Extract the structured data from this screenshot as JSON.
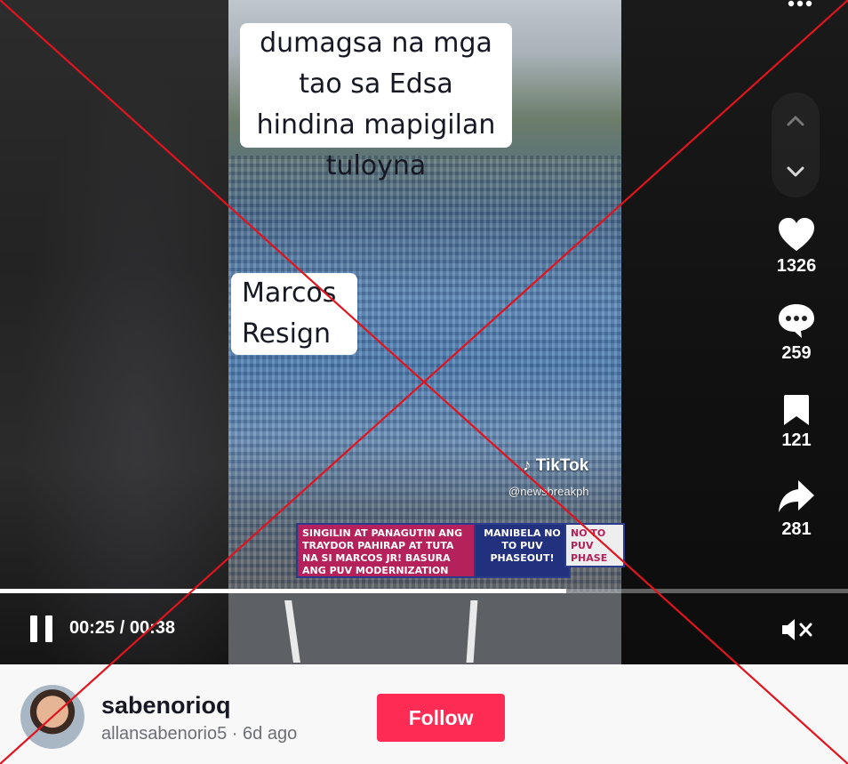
{
  "video": {
    "caption_top": "dumagsa na mga tao sa Edsa hindina mapigilan tuloyna",
    "caption_mid": "Marcos Resign",
    "banner_left": "SINGILIN AT PANAGUTIN ANG TRAYDOR PAHIRAP AT TUTA NA SI MARCOS JR! BASURA ANG PUV MODERNIZATION PROGRAM! PISTON · KMU · NO TO PUV PHASEOUT COALITION",
    "banner_mid": "MANIBELA NO TO PUV PHASEOUT!",
    "banner_right": "NO TO PUV PHASE OUT",
    "watermark_brand": "TikTok",
    "watermark_handle": "@newsbreakph"
  },
  "player": {
    "current_time": "00:25",
    "separator": " / ",
    "duration": "00:38",
    "progress_fraction": 0.668,
    "muted": true
  },
  "actions": {
    "likes": "1326",
    "comments": "259",
    "saves": "121",
    "shares": "281"
  },
  "author": {
    "username": "sabenorioq",
    "handle": "allansabenorio5",
    "separator": " · ",
    "posted": "6d ago",
    "follow_label": "Follow"
  },
  "colors": {
    "accent": "#fe2c55",
    "cross_overlay": "#e0141e",
    "player_bg": "#161616"
  },
  "icons": [
    "more-icon",
    "chevron-up-icon",
    "chevron-down-icon",
    "heart-icon",
    "comment-icon",
    "bookmark-icon",
    "share-icon",
    "pause-icon",
    "mute-icon"
  ]
}
